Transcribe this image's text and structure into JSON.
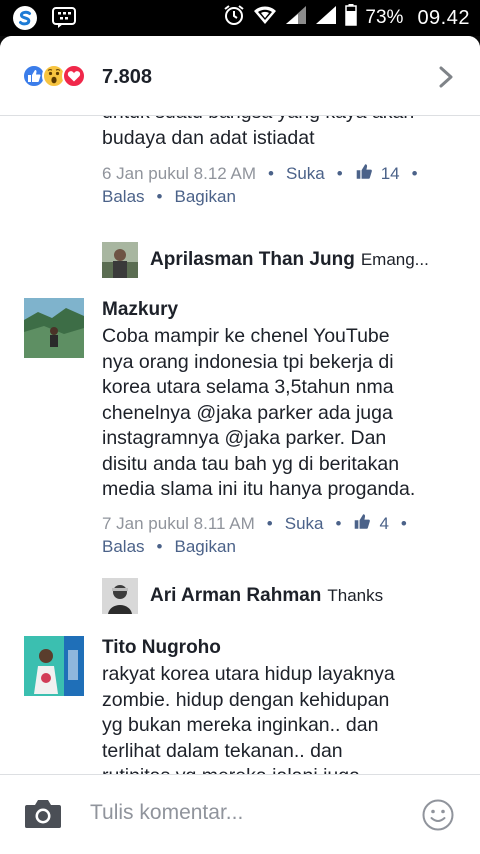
{
  "status_bar": {
    "battery": "73%",
    "time": "09.42",
    "icons": [
      "s-app-icon",
      "bbm-icon",
      "alarm-icon",
      "wifi-icon",
      "signal-icon",
      "signal-icon",
      "battery-icon"
    ]
  },
  "reactions": {
    "count": "7.808",
    "icons": [
      "like-icon",
      "wow-icon",
      "love-icon"
    ]
  },
  "comments": [
    {
      "text_lines": [
        "untuk suatu bangsa yang kaya akan",
        "budaya dan adat istiadat"
      ],
      "time": "6 Jan pukul 8.12 AM",
      "like_label": "Suka",
      "like_count": "14",
      "reply_label": "Balas",
      "share_label": "Bagikan",
      "reply_preview": {
        "name": "Aprilasman Than Jung",
        "text": "Emang..."
      }
    },
    {
      "name": "Mazkury",
      "text_lines": [
        "Coba mampir ke chenel YouTube",
        "nya orang indonesia tpi bekerja di",
        "korea utara selama 3,5tahun nma",
        "chenelnya @jaka parker ada juga",
        "instagramnya @jaka parker. Dan",
        "disitu anda tau bah yg di beritakan",
        "media slama ini itu hanya proganda."
      ],
      "time": "7 Jan pukul 8.11 AM",
      "like_label": "Suka",
      "like_count": "4",
      "reply_label": "Balas",
      "share_label": "Bagikan",
      "reply_preview": {
        "name": "Ari Arman Rahman",
        "text": "Thanks"
      }
    },
    {
      "name": "Tito Nugroho",
      "text_lines": [
        "rakyat korea utara hidup layaknya",
        "zombie. hidup dengan kehidupan",
        "yg bukan mereka inginkan.. dan",
        "terlihat dalam tekanan.. dan",
        "rutinitas yg mereka jalani juga"
      ]
    }
  ],
  "composer": {
    "placeholder": "Tulis komentar...",
    "left_icon": "camera-icon",
    "right_icon": "smiley-icon"
  }
}
